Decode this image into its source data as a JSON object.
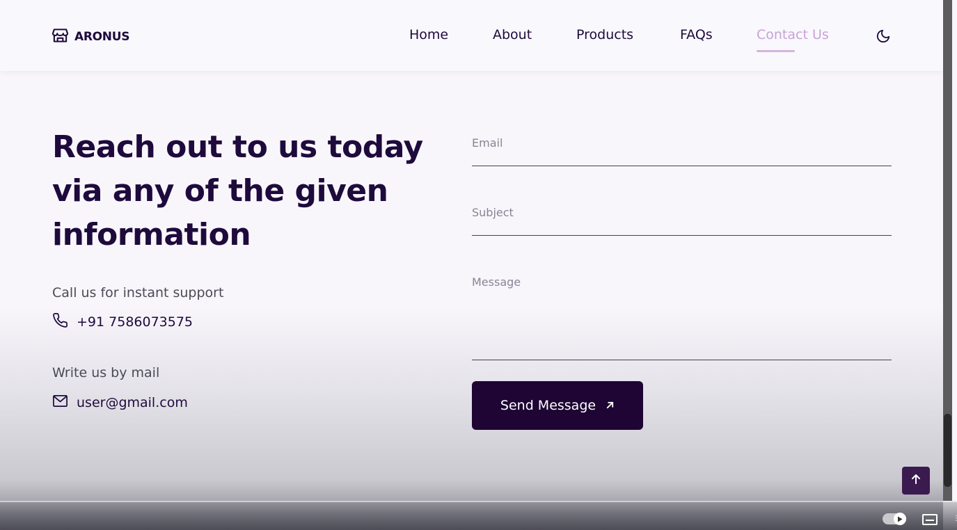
{
  "brand": {
    "name": "ARONUS"
  },
  "nav": {
    "items": [
      {
        "label": "Home"
      },
      {
        "label": "About"
      },
      {
        "label": "Products"
      },
      {
        "label": "FAQs"
      },
      {
        "label": "Contact Us"
      }
    ],
    "active_item": "Contact Us",
    "theme_toggle_icon": "moon-icon"
  },
  "hero": {
    "heading": "Reach out to us today via any of the given information"
  },
  "contact": {
    "phone_label": "Call us for instant support",
    "phone": "+91 7586073575",
    "mail_label": "Write us by mail",
    "email": "user@gmail.com"
  },
  "form": {
    "email_placeholder": "Email",
    "subject_placeholder": "Subject",
    "message_placeholder": "Message",
    "submit_label": "Send Message"
  },
  "colors": {
    "primary": "#1e0533",
    "active_nav": "#c8a2d8",
    "heading": "#1e0a3c"
  },
  "icons": {
    "logo": "store-icon",
    "phone": "phone-icon",
    "mail": "mail-icon",
    "send": "arrow-up-right-icon",
    "scroll_top": "arrow-up-icon",
    "captions": "captions-icon"
  }
}
